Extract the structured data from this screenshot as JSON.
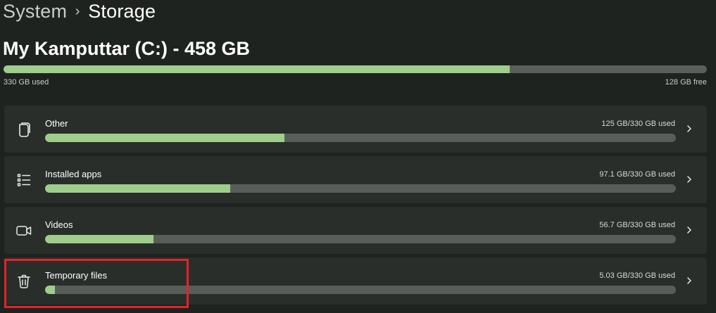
{
  "breadcrumb": {
    "parent": "System",
    "separator": "›",
    "current": "Storage"
  },
  "drive": {
    "title": "My Kamputtar (C:) - 458 GB",
    "used_label": "330 GB used",
    "free_label": "128 GB free",
    "used_fraction": 0.72
  },
  "categories": [
    {
      "label": "Other",
      "usage": "125 GB/330 GB used",
      "fraction": 0.379,
      "icon": "document-icon"
    },
    {
      "label": "Installed apps",
      "usage": "97.1 GB/330 GB used",
      "fraction": 0.294,
      "icon": "list-icon"
    },
    {
      "label": "Videos",
      "usage": "56.7 GB/330 GB used",
      "fraction": 0.172,
      "icon": "video-icon"
    },
    {
      "label": "Temporary files",
      "usage": "5.03 GB/330 GB used",
      "fraction": 0.015,
      "icon": "trash-icon"
    }
  ],
  "colors": {
    "accent": "#9ecd8c",
    "track": "#595d59",
    "card": "#2a2e2a",
    "background": "#1f231f",
    "highlight": "#e0242b"
  }
}
